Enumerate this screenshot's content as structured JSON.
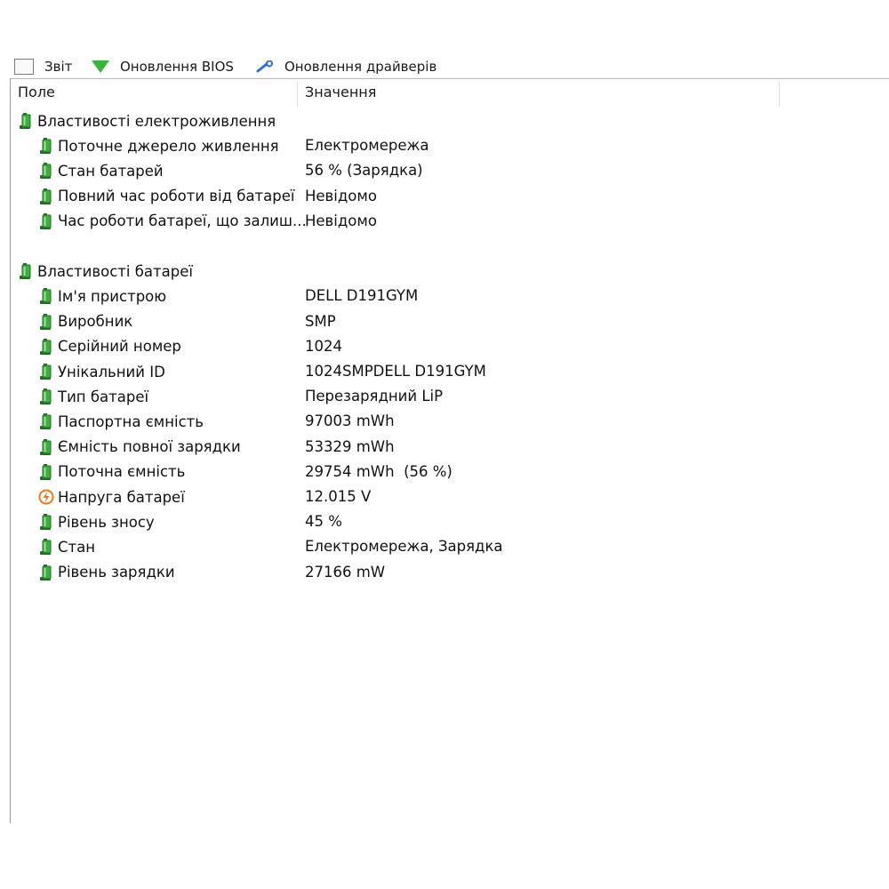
{
  "colors": {
    "battery_green": "#3fae3f",
    "battery_dark": "#1f6e24",
    "voltage_orange": "#f0761a"
  },
  "toolbar": [
    {
      "label": "Звіт",
      "icon": "report-icon"
    },
    {
      "label": "Оновлення BIOS",
      "icon": "check-icon"
    },
    {
      "label": "Оновлення драйверів",
      "icon": "wrench-icon"
    }
  ],
  "table": {
    "columns": [
      "Поле",
      "Значення"
    ],
    "groups": [
      {
        "title": "Властивості електроживлення",
        "icon": "battery-icon",
        "rows": [
          {
            "field": "Поточне джерело живлення",
            "value": "Електромережа",
            "icon": "battery-icon"
          },
          {
            "field": "Стан батарей",
            "value": "56 % (Зарядка)",
            "icon": "battery-icon"
          },
          {
            "field": "Повний час роботи від батареї",
            "value": "Невідомо",
            "icon": "battery-icon"
          },
          {
            "field": "Час роботи батареї, що залиш...",
            "value": "Невідомо",
            "icon": "battery-icon"
          }
        ]
      },
      {
        "title": "Властивості батареї",
        "icon": "battery-icon",
        "rows": [
          {
            "field": "Ім'я пристрою",
            "value": "DELL D191GYM",
            "icon": "battery-icon"
          },
          {
            "field": "Виробник",
            "value": "SMP",
            "icon": "battery-icon"
          },
          {
            "field": "Серійний номер",
            "value": "1024",
            "icon": "battery-icon"
          },
          {
            "field": "Унікальний ID",
            "value": "1024SMPDELL D191GYM",
            "icon": "battery-icon"
          },
          {
            "field": "Тип батареї",
            "value": "Перезарядний LiP",
            "icon": "battery-icon"
          },
          {
            "field": "Паспортна ємність",
            "value": "97003 mWh",
            "icon": "battery-icon"
          },
          {
            "field": "Ємність повної зарядки",
            "value": "53329 mWh",
            "icon": "battery-icon"
          },
          {
            "field": "Поточна ємність",
            "value": "29754 mWh  (56 %)",
            "icon": "battery-icon"
          },
          {
            "field": "Напруга батареї",
            "value": "12.015 V",
            "icon": "voltage-icon"
          },
          {
            "field": "Рівень зносу",
            "value": "45 %",
            "icon": "battery-icon"
          },
          {
            "field": "Стан",
            "value": "Електромережа, Зарядка",
            "icon": "battery-icon"
          },
          {
            "field": "Рівень зарядки",
            "value": "27166 mW",
            "icon": "battery-icon"
          }
        ]
      }
    ]
  }
}
